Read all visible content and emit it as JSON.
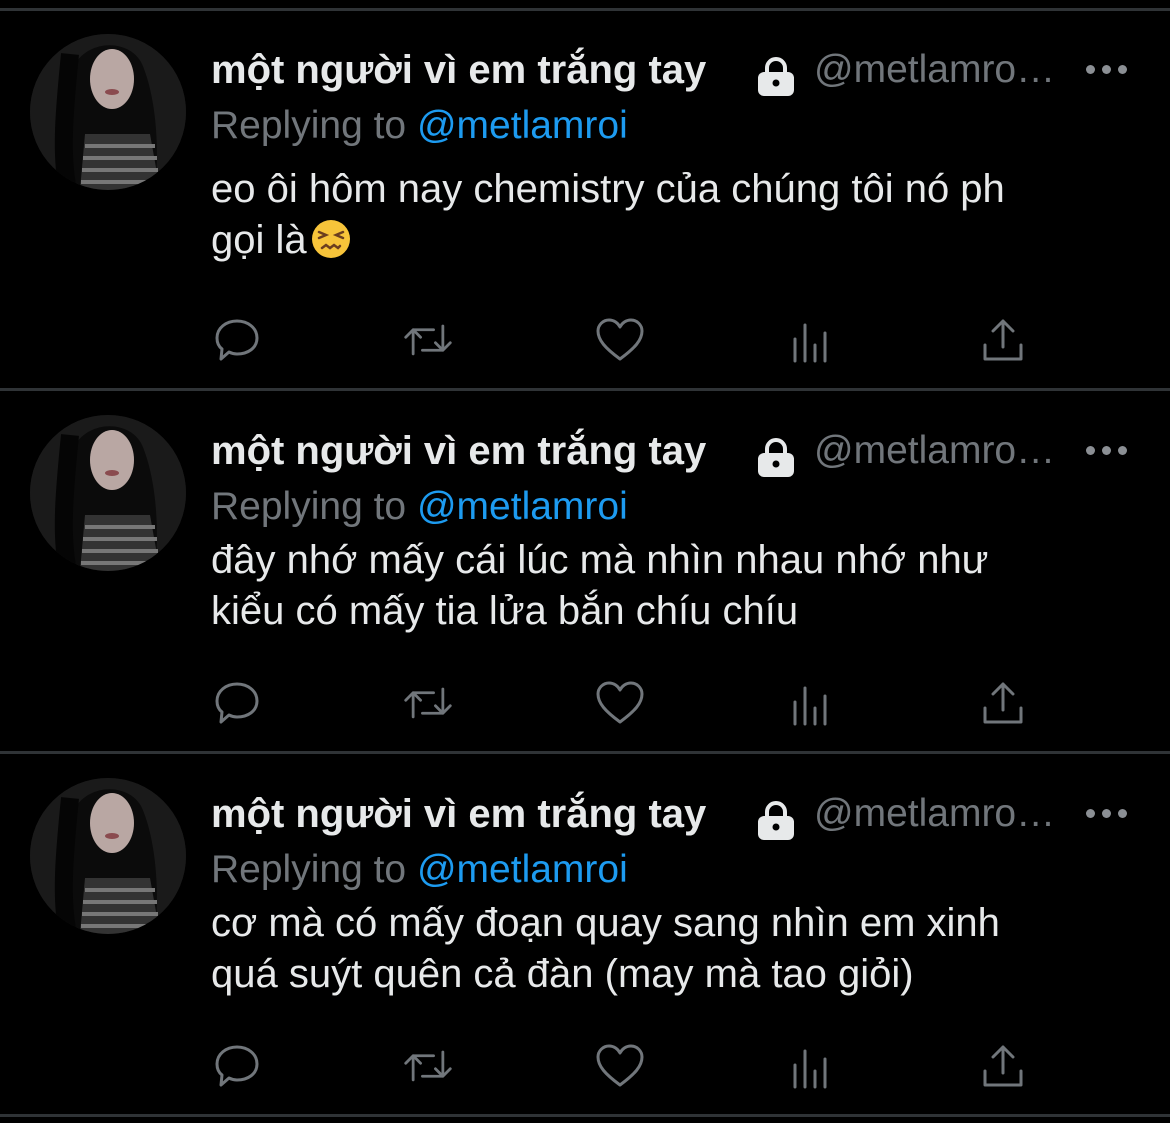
{
  "colors": {
    "background": "#000000",
    "text": "#e7e9ea",
    "muted": "#71767b",
    "accent": "#1d9bf0",
    "divider": "#2f3336"
  },
  "tweets": [
    {
      "display_name": "một người vì em trắng tay",
      "handle": "@metlamro…",
      "reply_prefix": "Replying to",
      "reply_handle": "@metlamroi",
      "text_lines": [
        "eo ôi hôm nay chemistry của chúng tôi nó ph",
        "gọi là"
      ],
      "emoji": "confounded-face-emoji",
      "icons": [
        "avatar",
        "lock-icon",
        "more-icon",
        "reply-icon",
        "retweet-icon",
        "like-icon",
        "analytics-icon",
        "share-icon"
      ]
    },
    {
      "display_name": "một người vì em trắng tay",
      "handle": "@metlamro…",
      "reply_prefix": "Replying to",
      "reply_handle": "@metlamroi",
      "text_lines": [
        "đây nhớ mấy cái lúc mà nhìn nhau nhớ như",
        "kiểu có mấy tia lửa bắn chíu chíu"
      ],
      "icons": [
        "avatar",
        "lock-icon",
        "more-icon",
        "reply-icon",
        "retweet-icon",
        "like-icon",
        "analytics-icon",
        "share-icon"
      ]
    },
    {
      "display_name": "một người vì em trắng tay",
      "handle": "@metlamro…",
      "reply_prefix": "Replying to",
      "reply_handle": "@metlamroi",
      "text_lines": [
        "cơ mà có mấy đoạn quay sang nhìn em xinh",
        "quá suýt quên cả đàn (may mà tao giỏi)"
      ],
      "icons": [
        "avatar",
        "lock-icon",
        "more-icon",
        "reply-icon",
        "retweet-icon",
        "like-icon",
        "analytics-icon",
        "share-icon"
      ]
    }
  ]
}
